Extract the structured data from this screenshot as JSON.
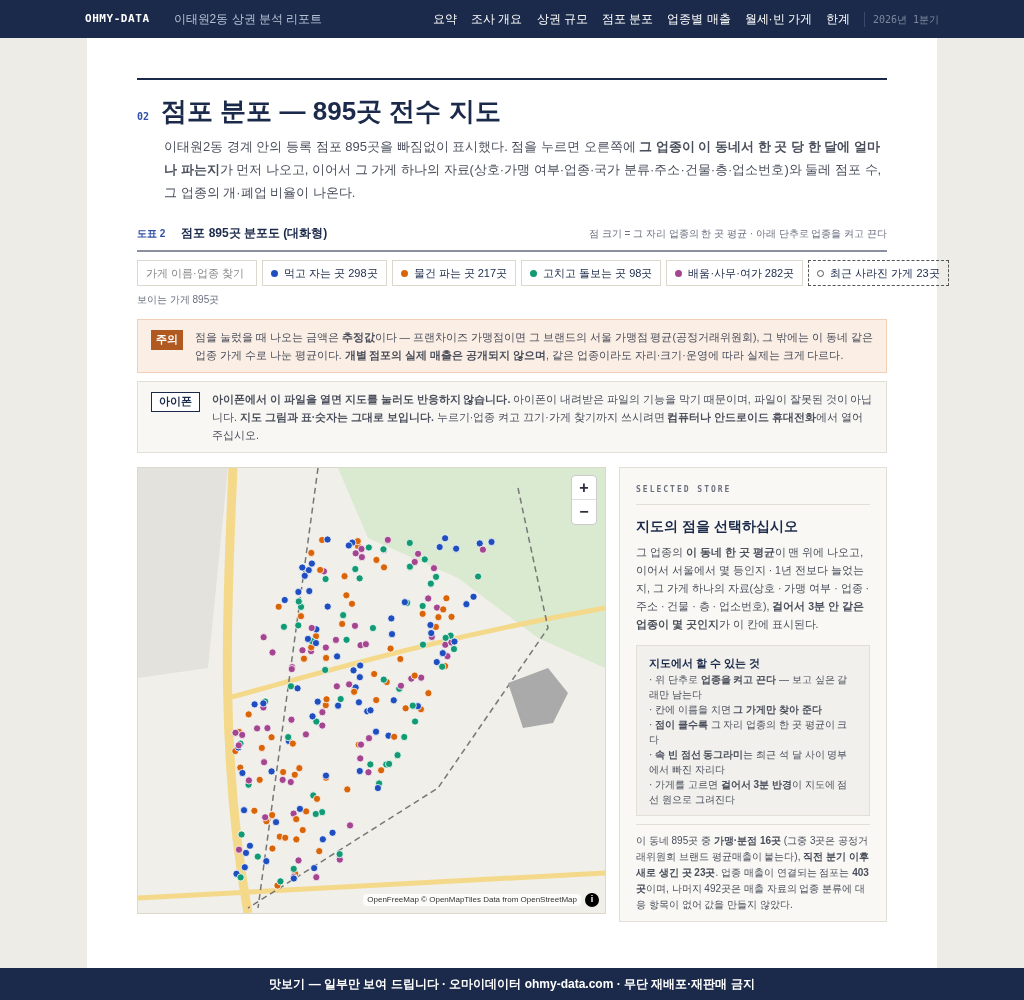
{
  "header": {
    "brand": "OHMY-DATA",
    "report_title": "이태원2동 상권 분석 리포트",
    "nav": [
      "요약",
      "조사 개요",
      "상권 규모",
      "점포 분포",
      "업종별 매출",
      "월세·빈 가게",
      "한계"
    ],
    "period": "2026년 1분기"
  },
  "section": {
    "number": "02",
    "title": "점포 분포 — 895곳 전수 지도",
    "intro": "이태원2동 경계 안의 등록 점포 895곳을 빠짐없이 표시했다. 점을 누르면 오른쪽에 **그 업종이 이 동네서 한 곳 당 한 달에 얼마나 파는지**가 먼저 나오고, 이어서 그 가게 하나의 자료(상호·가맹 여부·업종·국가 분류·주소·건물·층·업소번호)와 둘레 점포 수, 그 업종의 개·폐업 비율이 나온다."
  },
  "figure": {
    "label": "도표 2",
    "title": "점포 895곳 분포도 (대화형)",
    "note": "점 크기 = 그 자리 업종의 한 곳 평균 · 아래 단추로 업종을 켜고 끈다"
  },
  "search": {
    "placeholder": "가게 이름·업종 찾기"
  },
  "filters": [
    {
      "kind": "category",
      "label": "먹고 자는 곳 298곳",
      "color": "#1f4fbf"
    },
    {
      "kind": "category",
      "label": "물건 파는 곳 217곳",
      "color": "#d9650b"
    },
    {
      "kind": "category",
      "label": "고치고 돌보는 곳 98곳",
      "color": "#129a74"
    },
    {
      "kind": "category",
      "label": "배움·사무·여가 282곳",
      "color": "#a4468f"
    },
    {
      "kind": "closed",
      "label": "최근 사라진 가게 23곳"
    }
  ],
  "visible_count": "보이는 가게 895곳",
  "notices": [
    {
      "kind": "warning",
      "tag": "주의",
      "text": "점을 눌렀을 때 나오는 금액은 **추정값**이다 — 프랜차이즈 가맹점이면 그 브랜드의 서울 가맹점 평균(공정거래위원회), 그 밖에는 이 동네 같은 업종 가게 수로 나눈 평균이다. **개별 점포의 실제 매출은 공개되지 않으며**, 같은 업종이라도 자리·크기·운영에 따라 실제는 크게 다르다."
    },
    {
      "kind": "info",
      "tag": "아이폰",
      "text": "**아이폰에서 이 파일을 열면 지도를 눌러도 반응하지 않습니다.** 아이폰이 내려받은 파일의 기능을 막기 때문이며, 파일이 잘못된 것이 아닙니다. **지도 그림과 표·숫자는 그대로 보입니다.** 누르기·업종 켜고 끄기·가게 찾기까지 쓰시려면 **컴퓨터나 안드로이드 휴대전화**에서 열어 주십시오."
    }
  ],
  "map": {
    "zoom_in": "+",
    "zoom_out": "−",
    "attribution": "OpenFreeMap © OpenMapTiles Data from OpenStreetMap",
    "info": "i"
  },
  "panel": {
    "eyebrow": "SELECTED STORE",
    "title": "지도의 점을 선택하십시오",
    "body": "그 업종의 **이 동네 한 곳 평균**이 맨 위에 나오고, 이어서 서울에서 몇 등인지 · 1년 전보다 늘었는지, 그 가게 하나의 자료(상호 · 가맹 여부 · 업종 · 주소 · 건물 · 층 · 업소번호), **걸어서 3분 안 같은 업종이 몇 곳인지**가 이 칸에 표시된다.",
    "help_title": "지도에서 할 수 있는 것",
    "help_items": [
      "· 위 단추로 **업종을 켜고 끈다** — 보고 싶은 갈래만 남는다",
      "· 칸에 이름을 치면 **그 가게만 찾아 준다**",
      "· **점이 클수록** 그 자리 업종의 한 곳 평균이 크다",
      "· **속 빈 점선 동그라미**는 최근 석 달 사이 명부에서 빠진 자리다",
      "· 가게를 고르면 **걸어서 3분 반경**이 지도에 점선 원으로 그려진다"
    ],
    "summary": "이 동네 895곳 중 **가맹·분점 16곳** (그중 3곳은 공정거래위원회 브랜드 평균매출이 붙는다), **직전 분기 이후 새로 생긴 곳 23곳**. 업종 매출이 연결되는 점포는 **403곳**이며, 나머지 492곳은 매출 자료의 업종 분류에 대응 항목이 없어 값을 만들지 않았다."
  },
  "footer": "맛보기 — 일부만 보여 드립니다 · 오마이데이터 ohmy-data.com · 무단 재배포·재판매 금지"
}
